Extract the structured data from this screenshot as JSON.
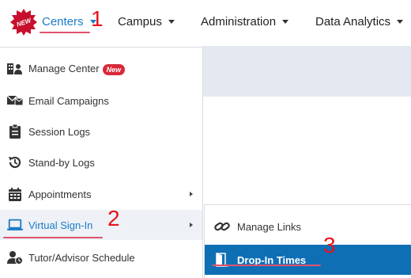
{
  "nav": {
    "badge_text": "NEW",
    "items": [
      {
        "label": "Centers"
      },
      {
        "label": "Campus"
      },
      {
        "label": "Administration"
      },
      {
        "label": "Data Analytics"
      }
    ]
  },
  "annotations": {
    "one": "1",
    "two": "2",
    "three": "3"
  },
  "dropdown": {
    "items": [
      {
        "label": "Manage Center",
        "badge": "New",
        "icon": "user-management-icon"
      },
      {
        "label": "Email Campaigns",
        "icon": "email-campaign-icon"
      },
      {
        "label": "Session Logs",
        "icon": "clipboard-icon"
      },
      {
        "label": "Stand-by Logs",
        "icon": "history-icon"
      },
      {
        "label": "Appointments",
        "icon": "calendar-icon",
        "has_submenu": true
      },
      {
        "label": "Virtual Sign-In",
        "icon": "laptop-icon",
        "has_submenu": true
      },
      {
        "label": "Tutor/Advisor Schedule",
        "icon": "user-clock-icon"
      }
    ]
  },
  "submenu": {
    "items": [
      {
        "label": "Manage Links",
        "icon": "link-icon"
      },
      {
        "label": "Drop-In Times",
        "icon": "door-open-icon",
        "selected": true
      }
    ]
  },
  "colors": {
    "accent": "#1a7bc6",
    "selected_bg": "#0f6fb5",
    "annotation": "#e8131b",
    "underline": "#e0526e",
    "new_badge": "#d9283a"
  }
}
